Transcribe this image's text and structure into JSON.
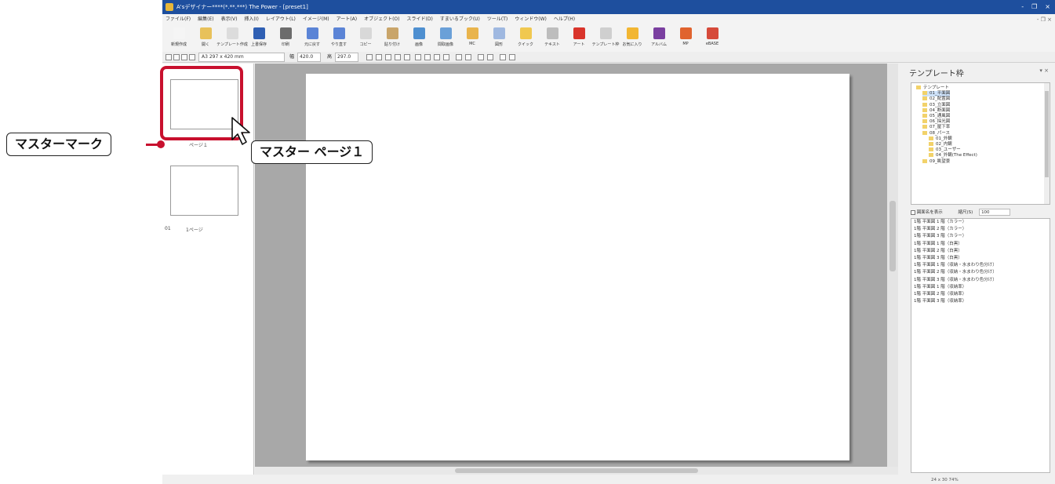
{
  "window": {
    "title": "A'sデザイナー****(*.**.***) The Power - [preset1]",
    "controls": [
      "-",
      "❐",
      "×"
    ]
  },
  "menu": [
    "ファイル(F)",
    "編集(E)",
    "表示(V)",
    "挿入(I)",
    "レイアウト(L)",
    "イメージ(M)",
    "アート(A)",
    "オブジェクト(O)",
    "スライド(D)",
    "すまいるブック(U)",
    "ツール(T)",
    "ウィンドウ(W)",
    "ヘルプ(H)"
  ],
  "toolbar": [
    {
      "label": "新規作成",
      "icon": "new-file-icon",
      "color": "#f5f5f5"
    },
    {
      "label": "開く",
      "icon": "open-folder-icon",
      "color": "#e8c15a"
    },
    {
      "label": "テンプレート作成",
      "icon": "template-create-icon",
      "color": "#dcdcdc"
    },
    {
      "label": "上書保存",
      "icon": "save-icon",
      "color": "#2f5fb3"
    },
    {
      "label": "印刷",
      "icon": "print-icon",
      "color": "#6c6c6c"
    },
    {
      "label": "元に戻す",
      "icon": "undo-icon",
      "color": "#5b84d6"
    },
    {
      "label": "やり直す",
      "icon": "redo-icon",
      "color": "#5b84d6"
    },
    {
      "label": "コピー",
      "icon": "copy-icon",
      "color": "#d8d8d8"
    },
    {
      "label": "貼り付け",
      "icon": "paste-icon",
      "color": "#c9a56a"
    },
    {
      "label": "画像",
      "icon": "image-icon",
      "color": "#4e8fd0"
    },
    {
      "label": "間取画像",
      "icon": "floorplan-image-icon",
      "color": "#6aa0d8"
    },
    {
      "label": "MC",
      "icon": "mc-icon",
      "color": "#e9b44c"
    },
    {
      "label": "図形",
      "icon": "shape-icon",
      "color": "#9fb8e0"
    },
    {
      "label": "クイック",
      "icon": "quick-icon",
      "color": "#f0c850"
    },
    {
      "label": "テキスト",
      "icon": "text-icon",
      "color": "#bdbdbd"
    },
    {
      "label": "アート",
      "icon": "art-icon",
      "color": "#d9342b"
    },
    {
      "label": "テンプレート枠",
      "icon": "template-frame-icon",
      "color": "#cfcfcf"
    },
    {
      "label": "お気に入り",
      "icon": "favorite-icon",
      "color": "#f2b632"
    },
    {
      "label": "アルバム",
      "icon": "album-icon",
      "color": "#7a3fa0"
    },
    {
      "label": "MP",
      "icon": "mp-icon",
      "color": "#e0632e"
    },
    {
      "label": "eBASE",
      "icon": "ebase-icon",
      "color": "#d64a3a"
    }
  ],
  "toolbar2": {
    "paper_size": "A3 297 x 420 mm",
    "width_label": "幅",
    "width_value": "420.0",
    "height_label": "高",
    "height_value": "297.0"
  },
  "pages": {
    "master_label": "ページ１",
    "page_num": "01",
    "page_label": "1ページ"
  },
  "right_panel": {
    "title": "テンプレート枠",
    "close": "▾ ×",
    "tree": [
      {
        "label": "テンプレート",
        "level": 0,
        "selected": false
      },
      {
        "label": "01_平面図",
        "level": 1,
        "selected": true
      },
      {
        "label": "02_配置図",
        "level": 1,
        "selected": false
      },
      {
        "label": "03_立面図",
        "level": 1,
        "selected": false
      },
      {
        "label": "04_断面図",
        "level": 1,
        "selected": false
      },
      {
        "label": "05_通風図",
        "level": 1,
        "selected": false
      },
      {
        "label": "06_採光図",
        "level": 1,
        "selected": false
      },
      {
        "label": "07_屋下率",
        "level": 1,
        "selected": false
      },
      {
        "label": "08_パース",
        "level": 1,
        "selected": false
      },
      {
        "label": "01_外観",
        "level": 2,
        "selected": false
      },
      {
        "label": "02_内観",
        "level": 2,
        "selected": false
      },
      {
        "label": "03_ユーザー",
        "level": 2,
        "selected": false
      },
      {
        "label": "04_外観(The Effect)",
        "level": 2,
        "selected": false
      },
      {
        "label": "09_眺望景",
        "level": 1,
        "selected": false
      }
    ],
    "option_checkbox": "図面名を表示",
    "option_display": "縮尺(S)",
    "option_value": "100",
    "list": [
      "1階 平面図 1 階（カラー）",
      "1階 平面図 2 階（カラー）",
      "1階 平面図 3 階（カラー）",
      "1階 平面図 1 階（白黒）",
      "1階 平面図 2 階（白黒）",
      "1階 平面図 3 階（白黒）",
      "1階 平面図 1 階（収納・水まわり色分け）",
      "1階 平面図 2 階（収納・水まわり色分け）",
      "1階 平面図 3 階（収納・水まわり色分け）",
      "1階 平面図 1 階（収納率）",
      "1階 平面図 2 階（収納率）",
      "1階 平面図 3 階（収納率）"
    ],
    "status": "24 x 30    74%"
  },
  "annotations": {
    "master_mark": "マスターマーク",
    "master_page": "マスター ページ１"
  },
  "colors": {
    "titlebar": "#1e4f9e",
    "highlight": "#c8102e"
  }
}
